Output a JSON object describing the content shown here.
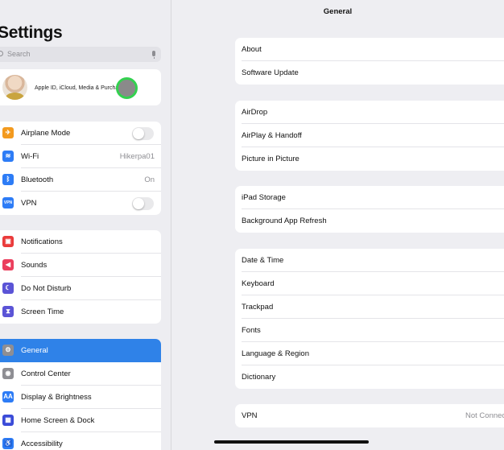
{
  "sidebar": {
    "title": "Settings",
    "search_placeholder": "Search",
    "profile_text": "Apple ID, iCloud, Media & Purchases",
    "groups": [
      [
        {
          "label": "Airplane Mode",
          "icon": "airplane-icon",
          "color": "#f39a1e",
          "toggle": false,
          "value": ""
        },
        {
          "label": "Wi-Fi",
          "icon": "wifi-icon",
          "color": "#2d7cf6",
          "value": "Hikerpa01"
        },
        {
          "label": "Bluetooth",
          "icon": "bluetooth-icon",
          "color": "#2d7cf6",
          "value": "On"
        },
        {
          "label": "VPN",
          "icon": "vpn-icon",
          "color": "#2d7cf6",
          "toggle": false,
          "value": ""
        }
      ],
      [
        {
          "label": "Notifications",
          "icon": "notifications-icon",
          "color": "#ea3b3b",
          "value": ""
        },
        {
          "label": "Sounds",
          "icon": "sounds-icon",
          "color": "#eb3f5d",
          "value": ""
        },
        {
          "label": "Do Not Disturb",
          "icon": "moon-icon",
          "color": "#5b54d6",
          "value": ""
        },
        {
          "label": "Screen Time",
          "icon": "hourglass-icon",
          "color": "#5b54d6",
          "value": ""
        }
      ],
      [
        {
          "label": "General",
          "icon": "gear-icon",
          "color": "#8e8e93",
          "value": "",
          "selected": true
        },
        {
          "label": "Control Center",
          "icon": "switches-icon",
          "color": "#8e8e93",
          "value": ""
        },
        {
          "label": "Display & Brightness",
          "icon": "display-icon",
          "color": "#2d7cf6",
          "value": ""
        },
        {
          "label": "Home Screen & Dock",
          "icon": "grid-icon",
          "color": "#3a4bd8",
          "value": ""
        },
        {
          "label": "Accessibility",
          "icon": "accessibility-icon",
          "color": "#2d7cf6",
          "value": ""
        }
      ]
    ]
  },
  "detail": {
    "title": "General",
    "groups": [
      [
        {
          "label": "About"
        },
        {
          "label": "Software Update"
        }
      ],
      [
        {
          "label": "AirDrop"
        },
        {
          "label": "AirPlay & Handoff"
        },
        {
          "label": "Picture in Picture"
        }
      ],
      [
        {
          "label": "iPad Storage"
        },
        {
          "label": "Background App Refresh"
        }
      ],
      [
        {
          "label": "Date & Time"
        },
        {
          "label": "Keyboard"
        },
        {
          "label": "Trackpad"
        },
        {
          "label": "Fonts"
        },
        {
          "label": "Language & Region"
        },
        {
          "label": "Dictionary"
        }
      ],
      [
        {
          "label": "VPN",
          "value": "Not Connected"
        }
      ]
    ]
  }
}
